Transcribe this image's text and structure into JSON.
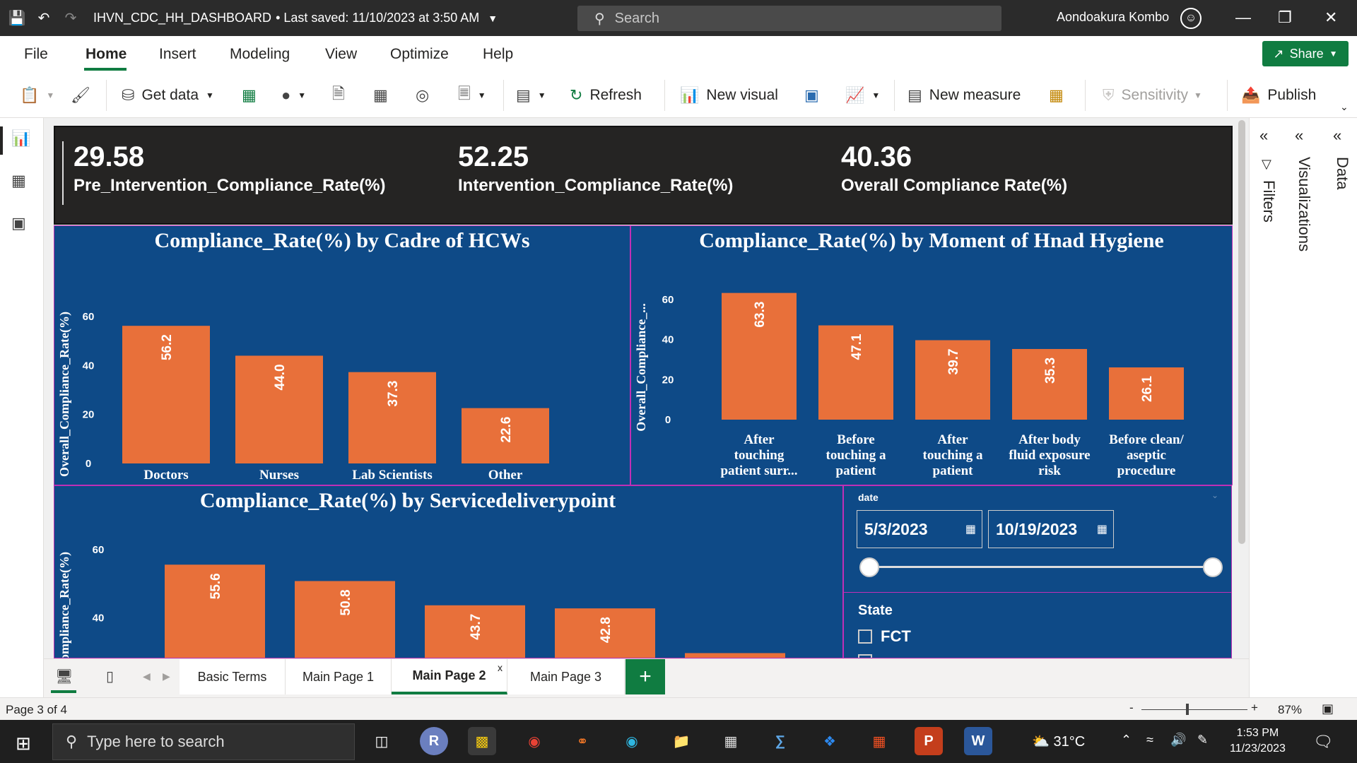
{
  "titlebar": {
    "file_name": "IHVN_CDC_HH_DASHBOARD",
    "saved": "• Last saved: 11/10/2023 at 3:50 AM",
    "search_placeholder": "Search",
    "user": "Aondoakura Kombo"
  },
  "menu": {
    "items": [
      "File",
      "Home",
      "Insert",
      "Modeling",
      "View",
      "Optimize",
      "Help"
    ],
    "active": "Home",
    "share": "Share"
  },
  "ribbon": {
    "get_data": "Get data",
    "refresh": "Refresh",
    "new_visual": "New visual",
    "new_measure": "New measure",
    "sensitivity": "Sensitivity",
    "publish": "Publish"
  },
  "kpis": [
    {
      "value": "29.58",
      "label": "Pre_Intervention_Compliance_Rate(%)"
    },
    {
      "value": "52.25",
      "label": "Intervention_Compliance_Rate(%)"
    },
    {
      "value": "40.36",
      "label": "Overall Compliance Rate(%)"
    }
  ],
  "chart_data": [
    {
      "type": "bar",
      "title": "Compliance_Rate(%) by Cadre of HCWs",
      "ylabel": "Overall_Compliance_Rate(%)",
      "xlabel": "",
      "categories": [
        "Doctors",
        "Nurses",
        "Lab Scientists",
        "Other"
      ],
      "values": [
        56.2,
        44.0,
        37.3,
        22.6
      ],
      "ylim": [
        0,
        60
      ],
      "yticks": [
        0,
        20,
        40,
        60
      ],
      "color": "#e8703a"
    },
    {
      "type": "bar",
      "title": "Compliance_Rate(%) by Moment of Hnad Hygiene",
      "ylabel": "Overall_Compliance_...",
      "xlabel": "",
      "categories": [
        "After touching patient surr...",
        "Before touching a patient",
        "After touching a patient",
        "After body fluid exposure risk",
        "Before clean/ aseptic procedure"
      ],
      "values": [
        63.3,
        47.1,
        39.7,
        35.3,
        26.1
      ],
      "ylim": [
        0,
        60
      ],
      "yticks": [
        0,
        20,
        40,
        60
      ],
      "color": "#e8703a"
    },
    {
      "type": "bar",
      "title": "Compliance_Rate(%) by Servicedeliverypoint",
      "ylabel": "ompliance_Rate(%)",
      "xlabel": "",
      "categories": [],
      "values": [
        55.6,
        50.8,
        43.7,
        42.8,
        29.7
      ],
      "ylim": [
        0,
        60
      ],
      "yticks": [
        40,
        60
      ],
      "color": "#e8703a"
    }
  ],
  "slicer": {
    "date_label": "date",
    "start_date": "5/3/2023",
    "end_date": "10/19/2023",
    "state_label": "State",
    "state_options": [
      "FCT"
    ]
  },
  "right_panes": {
    "filters": "Filters",
    "visualizations": "Visualizations",
    "data": "Data"
  },
  "page_tabs": {
    "tabs": [
      "Basic Terms",
      "Main Page 1",
      "Main Page 2",
      "Main Page 3"
    ],
    "active": "Main Page 2",
    "close": "x",
    "add": "+"
  },
  "status": {
    "page": "Page 3 of 4",
    "zoom": "87%",
    "zoom_minus": "-",
    "zoom_plus": "+"
  },
  "taskbar": {
    "search_placeholder": "Type here to search",
    "weather": "31°C",
    "time": "1:53 PM",
    "date": "11/23/2023"
  }
}
